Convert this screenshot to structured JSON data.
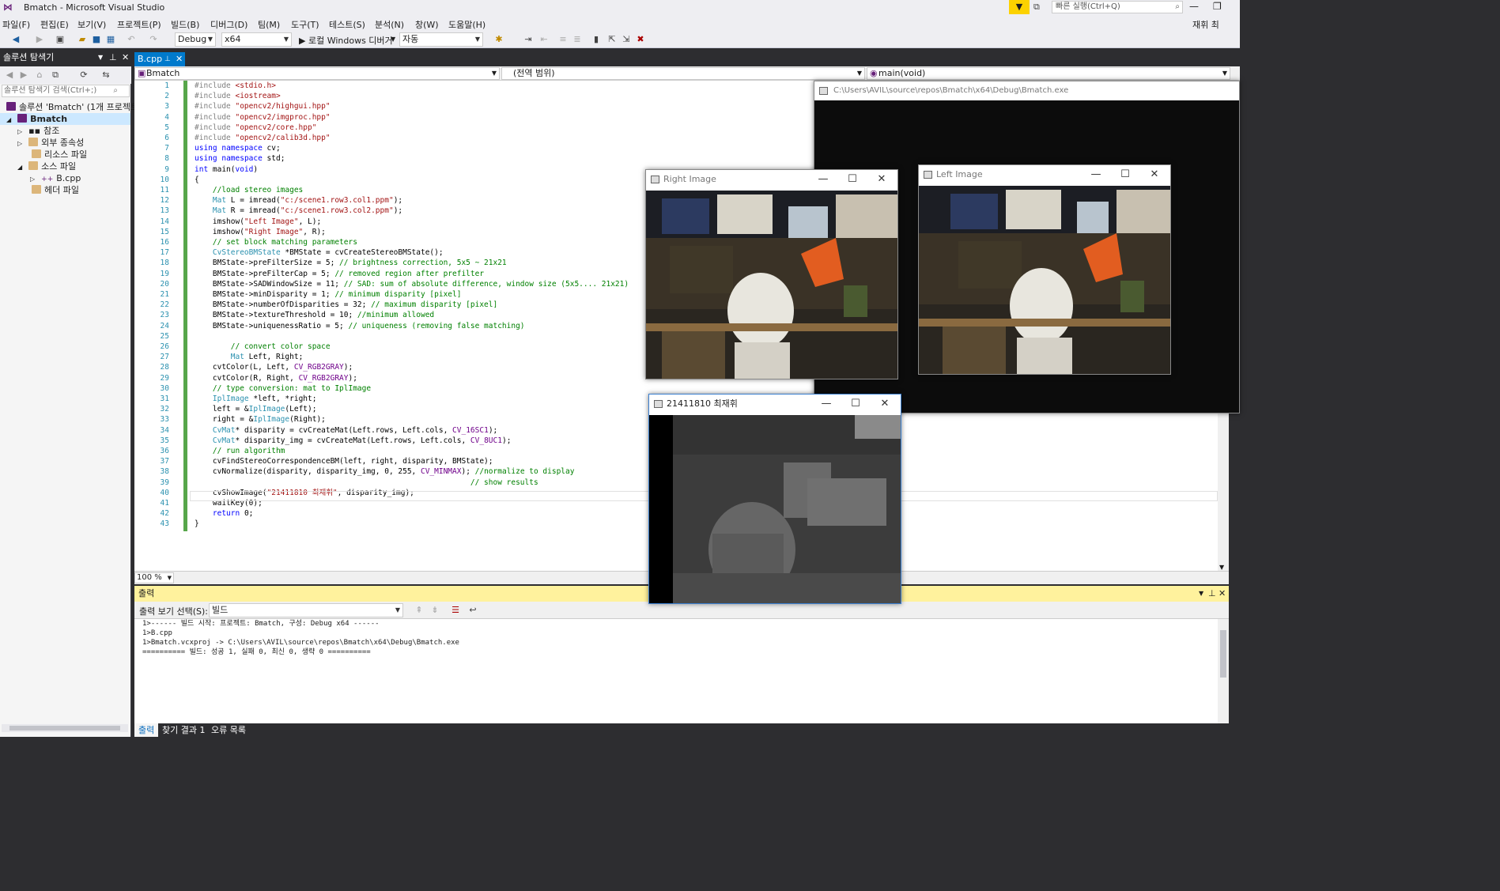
{
  "app": {
    "title": "Bmatch - Microsoft Visual Studio",
    "quick_launch_placeholder": "빠른 실행(Ctrl+Q)",
    "user": "재휘 최"
  },
  "menu": [
    "파일(F)",
    "편집(E)",
    "보기(V)",
    "프로젝트(P)",
    "빌드(B)",
    "디버그(D)",
    "팀(M)",
    "도구(T)",
    "테스트(S)",
    "분석(N)",
    "창(W)",
    "도움말(H)"
  ],
  "toolbar": {
    "config": "Debug",
    "platform": "x64",
    "run_label": "▶ 로컬 Windows 디버거",
    "auto": "자동"
  },
  "solution_explorer": {
    "title": "솔루션 탐색기",
    "search_placeholder": "솔루션 탐색기 검색(Ctrl+;)",
    "items": [
      "솔루션 'Bmatch' (1개 프로젝트",
      "Bmatch",
      "참조",
      "외부 종속성",
      "리소스 파일",
      "소스 파일",
      "B.cpp",
      "헤더 파일"
    ]
  },
  "editor": {
    "tab": "B.cpp",
    "nav_project": "Bmatch",
    "nav_scope": "(전역 범위)",
    "nav_member": "main(void)",
    "zoom": "100 %"
  },
  "code_lines": [
    "#include <stdio.h>",
    "#include <iostream>",
    "#include \"opencv2/highgui.hpp\"",
    "#include \"opencv2/imgproc.hpp\"",
    "#include \"opencv2/core.hpp\"",
    "#include \"opencv2/calib3d.hpp\"",
    "using namespace cv;",
    "using namespace std;",
    "int main(void)",
    "{",
    "    //load stereo images",
    "    Mat L = imread(\"c:/scene1.row3.col1.ppm\");",
    "    Mat R = imread(\"c:/scene1.row3.col2.ppm\");",
    "    imshow(\"Left Image\", L);",
    "    imshow(\"Right Image\", R);",
    "    // set block matching parameters",
    "    CvStereoBMState *BMState = cvCreateStereoBMState();",
    "    BMState->preFilterSize = 5; // brightness correction, 5x5 ~ 21x21",
    "    BMState->preFilterCap = 5; // removed region after prefilter",
    "    BMState->SADWindowSize = 11; // SAD: sum of absolute difference, window size (5x5.... 21x21)",
    "    BMState->minDisparity = 1; // minimum disparity [pixel]",
    "    BMState->numberOfDisparities = 32; // maximum disparity [pixel]",
    "    BMState->textureThreshold = 10; //minimum allowed",
    "    BMState->uniquenessRatio = 5; // uniqueness (removing false matching)",
    "",
    "        // convert color space",
    "        Mat Left, Right;",
    "    cvtColor(L, Left, CV_RGB2GRAY);",
    "    cvtColor(R, Right, CV_RGB2GRAY);",
    "    // type conversion: mat to IplImage",
    "    IplImage *left, *right;",
    "    left = &IplImage(Left);",
    "    right = &IplImage(Right);",
    "    CvMat* disparity = cvCreateMat(Left.rows, Left.cols, CV_16SC1);",
    "    CvMat* disparity_img = cvCreateMat(Left.rows, Left.cols, CV_8UC1);",
    "    // run algorithm",
    "    cvFindStereoCorrespondenceBM(left, right, disparity, BMState);",
    "    cvNormalize(disparity, disparity_img, 0, 255, CV_MINMAX); //normalize to display",
    "                                                             // show results",
    "    cvShowImage(\"21411810 최재휘\", disparity_img);",
    "    waitKey(0);",
    "    return 0;",
    "}"
  ],
  "console_window": {
    "title": "C:\\Users\\AVIL\\source\\repos\\Bmatch\\x64\\Debug\\Bmatch.exe"
  },
  "right_image_window": {
    "title": "Right Image"
  },
  "left_image_window": {
    "title": "Left Image"
  },
  "disparity_window": {
    "title": "21411810 최재휘"
  },
  "output": {
    "title": "출력",
    "source_label": "출력 보기 선택(S):",
    "source_value": "빌드",
    "lines": [
      "1>------ 빌드 시작: 프로젝트: Bmatch, 구성: Debug x64 ------",
      "1>B.cpp",
      "1>Bmatch.vcxproj -> C:\\Users\\AVIL\\source\\repos\\Bmatch\\x64\\Debug\\Bmatch.exe",
      "========== 빌드: 성공 1, 실패 0, 최신 0, 생략 0 =========="
    ]
  },
  "bottom_tabs": [
    "출력",
    "찾기 결과 1",
    "오류 목록"
  ]
}
